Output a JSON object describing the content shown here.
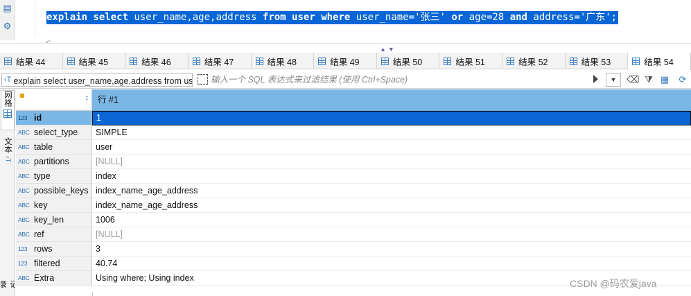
{
  "editor": {
    "sql_parts": [
      {
        "text": "explain select",
        "kw": true
      },
      {
        "text": " user_name,age,address ",
        "kw": false
      },
      {
        "text": "from",
        "kw": true
      },
      {
        "text": " ",
        "kw": false
      },
      {
        "text": "user",
        "kw": true
      },
      {
        "text": " ",
        "kw": false
      },
      {
        "text": "where",
        "kw": true
      },
      {
        "text": " user_name='张三' ",
        "kw": false
      },
      {
        "text": "or",
        "kw": true
      },
      {
        "text": " age=28 ",
        "kw": false
      },
      {
        "text": "and",
        "kw": true
      },
      {
        "text": " address='广东';",
        "kw": false
      }
    ],
    "gutter_icons": [
      "script-icon",
      "gear-icon"
    ],
    "scroll_left_glyph": "<"
  },
  "tabs": {
    "items": [
      {
        "label": "结果 44"
      },
      {
        "label": "结果 45"
      },
      {
        "label": "结果 46"
      },
      {
        "label": "结果 47"
      },
      {
        "label": "结果 48"
      },
      {
        "label": "结果 49"
      },
      {
        "label": "结果 50"
      },
      {
        "label": "结果 51"
      },
      {
        "label": "结果 52"
      },
      {
        "label": "结果 53"
      },
      {
        "label": "结果 54"
      }
    ],
    "active_index": 10
  },
  "filterbar": {
    "query_prefix": "‹T",
    "query_text": "explain select user_name,age,address from user where user_name='张三' or age=28 and address='广东'",
    "filter_placeholder": "输入一个 SQL 表达式来过滤结果 (使用 Ctrl+Space)",
    "history_glyph": "▼"
  },
  "sidepanel": {
    "grid_tab_label": "网格",
    "text_tab_label": "文本",
    "record_tab_label": "记录"
  },
  "grid": {
    "column_header": "行 #1",
    "rows": [
      {
        "type": "123",
        "name": "id",
        "value": "1",
        "null": false,
        "selected": true
      },
      {
        "type": "ABC",
        "name": "select_type",
        "value": "SIMPLE",
        "null": false
      },
      {
        "type": "ABC",
        "name": "table",
        "value": "user",
        "null": false
      },
      {
        "type": "ABC",
        "name": "partitions",
        "value": "[NULL]",
        "null": true
      },
      {
        "type": "ABC",
        "name": "type",
        "value": "index",
        "null": false
      },
      {
        "type": "ABC",
        "name": "possible_keys",
        "value": "index_name_age_address",
        "null": false
      },
      {
        "type": "ABC",
        "name": "key",
        "value": "index_name_age_address",
        "null": false
      },
      {
        "type": "ABC",
        "name": "key_len",
        "value": "1006",
        "null": false
      },
      {
        "type": "ABC",
        "name": "ref",
        "value": "[NULL]",
        "null": true
      },
      {
        "type": "123",
        "name": "rows",
        "value": "3",
        "null": false
      },
      {
        "type": "123",
        "name": "filtered",
        "value": "40.74",
        "null": false
      },
      {
        "type": "ABC",
        "name": "Extra",
        "value": "Using where; Using index",
        "null": false
      }
    ]
  },
  "watermark": "CSDN @码农爱java",
  "colors": {
    "selection": "#0a66d6",
    "header_blue": "#7bb6e5",
    "icon_blue": "#3d7fbf"
  }
}
